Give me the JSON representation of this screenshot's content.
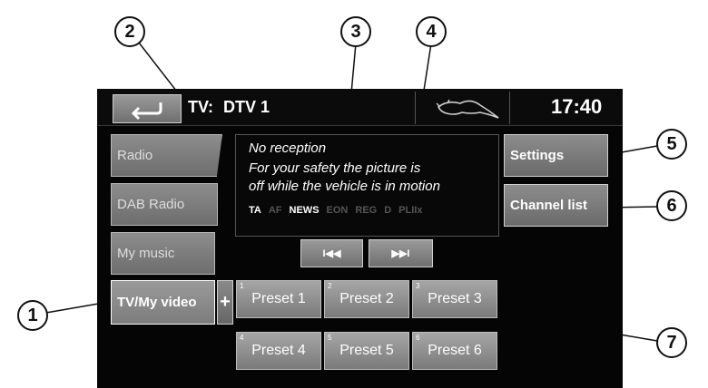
{
  "header": {
    "source_label": "TV:",
    "channel": "DTV 1",
    "clock": "17:40"
  },
  "sources": [
    {
      "label": "Radio"
    },
    {
      "label": "DAB Radio"
    },
    {
      "label": "My music"
    },
    {
      "label": "TV/My video"
    }
  ],
  "add_label": "+",
  "info": {
    "line1": "No reception",
    "line2": "For your safety the picture is",
    "line3": "off while the vehicle is in motion"
  },
  "flags": [
    {
      "label": "TA",
      "active": true
    },
    {
      "label": "AF",
      "active": false
    },
    {
      "label": "NEWS",
      "active": true
    },
    {
      "label": "EON",
      "active": false
    },
    {
      "label": "REG",
      "active": false
    },
    {
      "label": "D",
      "active": false
    },
    {
      "label": "PLIIx",
      "active": false
    }
  ],
  "seek": {
    "prev": "I◀◀",
    "next": "▶▶I"
  },
  "right_buttons": {
    "settings": "Settings",
    "channel_list": "Channel list"
  },
  "presets": [
    {
      "num": "1",
      "label": "Preset 1"
    },
    {
      "num": "2",
      "label": "Preset 2"
    },
    {
      "num": "3",
      "label": "Preset 3"
    },
    {
      "num": "4",
      "label": "Preset 4"
    },
    {
      "num": "5",
      "label": "Preset 5"
    },
    {
      "num": "6",
      "label": "Preset 6"
    }
  ],
  "callouts": [
    "1",
    "2",
    "3",
    "4",
    "5",
    "6",
    "7"
  ],
  "colors": {
    "flag_active": "#ffffff",
    "flag_inactive": "#555555"
  }
}
